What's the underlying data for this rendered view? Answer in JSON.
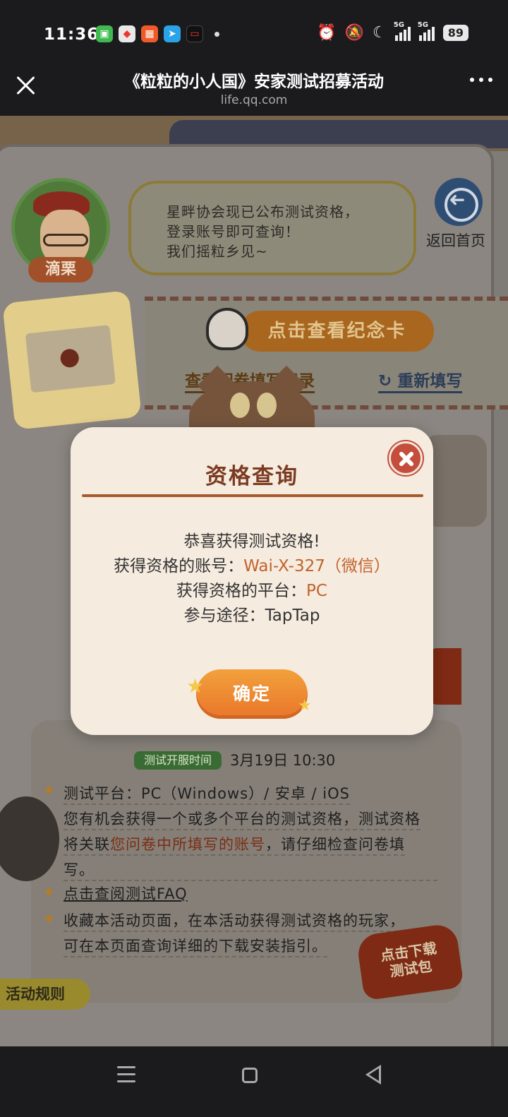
{
  "status_bar": {
    "time": "11:36",
    "battery": "89",
    "signal_1": "5G",
    "signal_2": "5G"
  },
  "titlebar": {
    "title": "《粒粒的小人国》安家测试招募活动",
    "url": "life.qq.com"
  },
  "character": {
    "name": "滴栗",
    "speech_lines": [
      "星畔协会现已公布测试资格，",
      "登录账号即可查询！",
      "我们摇粒乡见~"
    ]
  },
  "home": {
    "label": "返回首页"
  },
  "memorial": {
    "button_label": "点击查看纪念卡",
    "link_records": "查看问卷填写记录",
    "link_refill": "重新填写"
  },
  "modal": {
    "title": "资格查询",
    "congrats": "恭喜获得测试资格!",
    "account_label": "获得资格的账号：",
    "account_value": "Wai-X-327（微信）",
    "platform_label": "获得资格的平台：",
    "platform_value": "PC",
    "channel_label": "参与途径：",
    "channel_value": "TapTap",
    "confirm_label": "确定"
  },
  "rules": {
    "badge": "测试开服时间",
    "date": "3月19日 10:30",
    "platform_line": "测试平台：PC（Windows）/ 安卓 / iOS",
    "desc_1": "您有机会获得一个或多个平台的测试资格，测试资格",
    "desc_2_pre": "将关联",
    "desc_2_emph": "您问卷中所填写的账号",
    "desc_2_post": "，请仔细检查问卷填",
    "desc_3": "写。",
    "faq": "点击查阅测试FAQ",
    "bookmark_1": "收藏本活动页面，在本活动获得测试资格的玩家，",
    "bookmark_2": "可在本页面查询详细的下载安装指引。",
    "download_1": "点击下载",
    "download_2": "测试包",
    "tab": "活动规则"
  },
  "colors": {
    "accent_orange": "#e9752a",
    "modal_bg": "#f6ebdf",
    "title_brown": "#7b3b22",
    "value_orange": "#c0632b",
    "close_red": "#c44d3b"
  }
}
